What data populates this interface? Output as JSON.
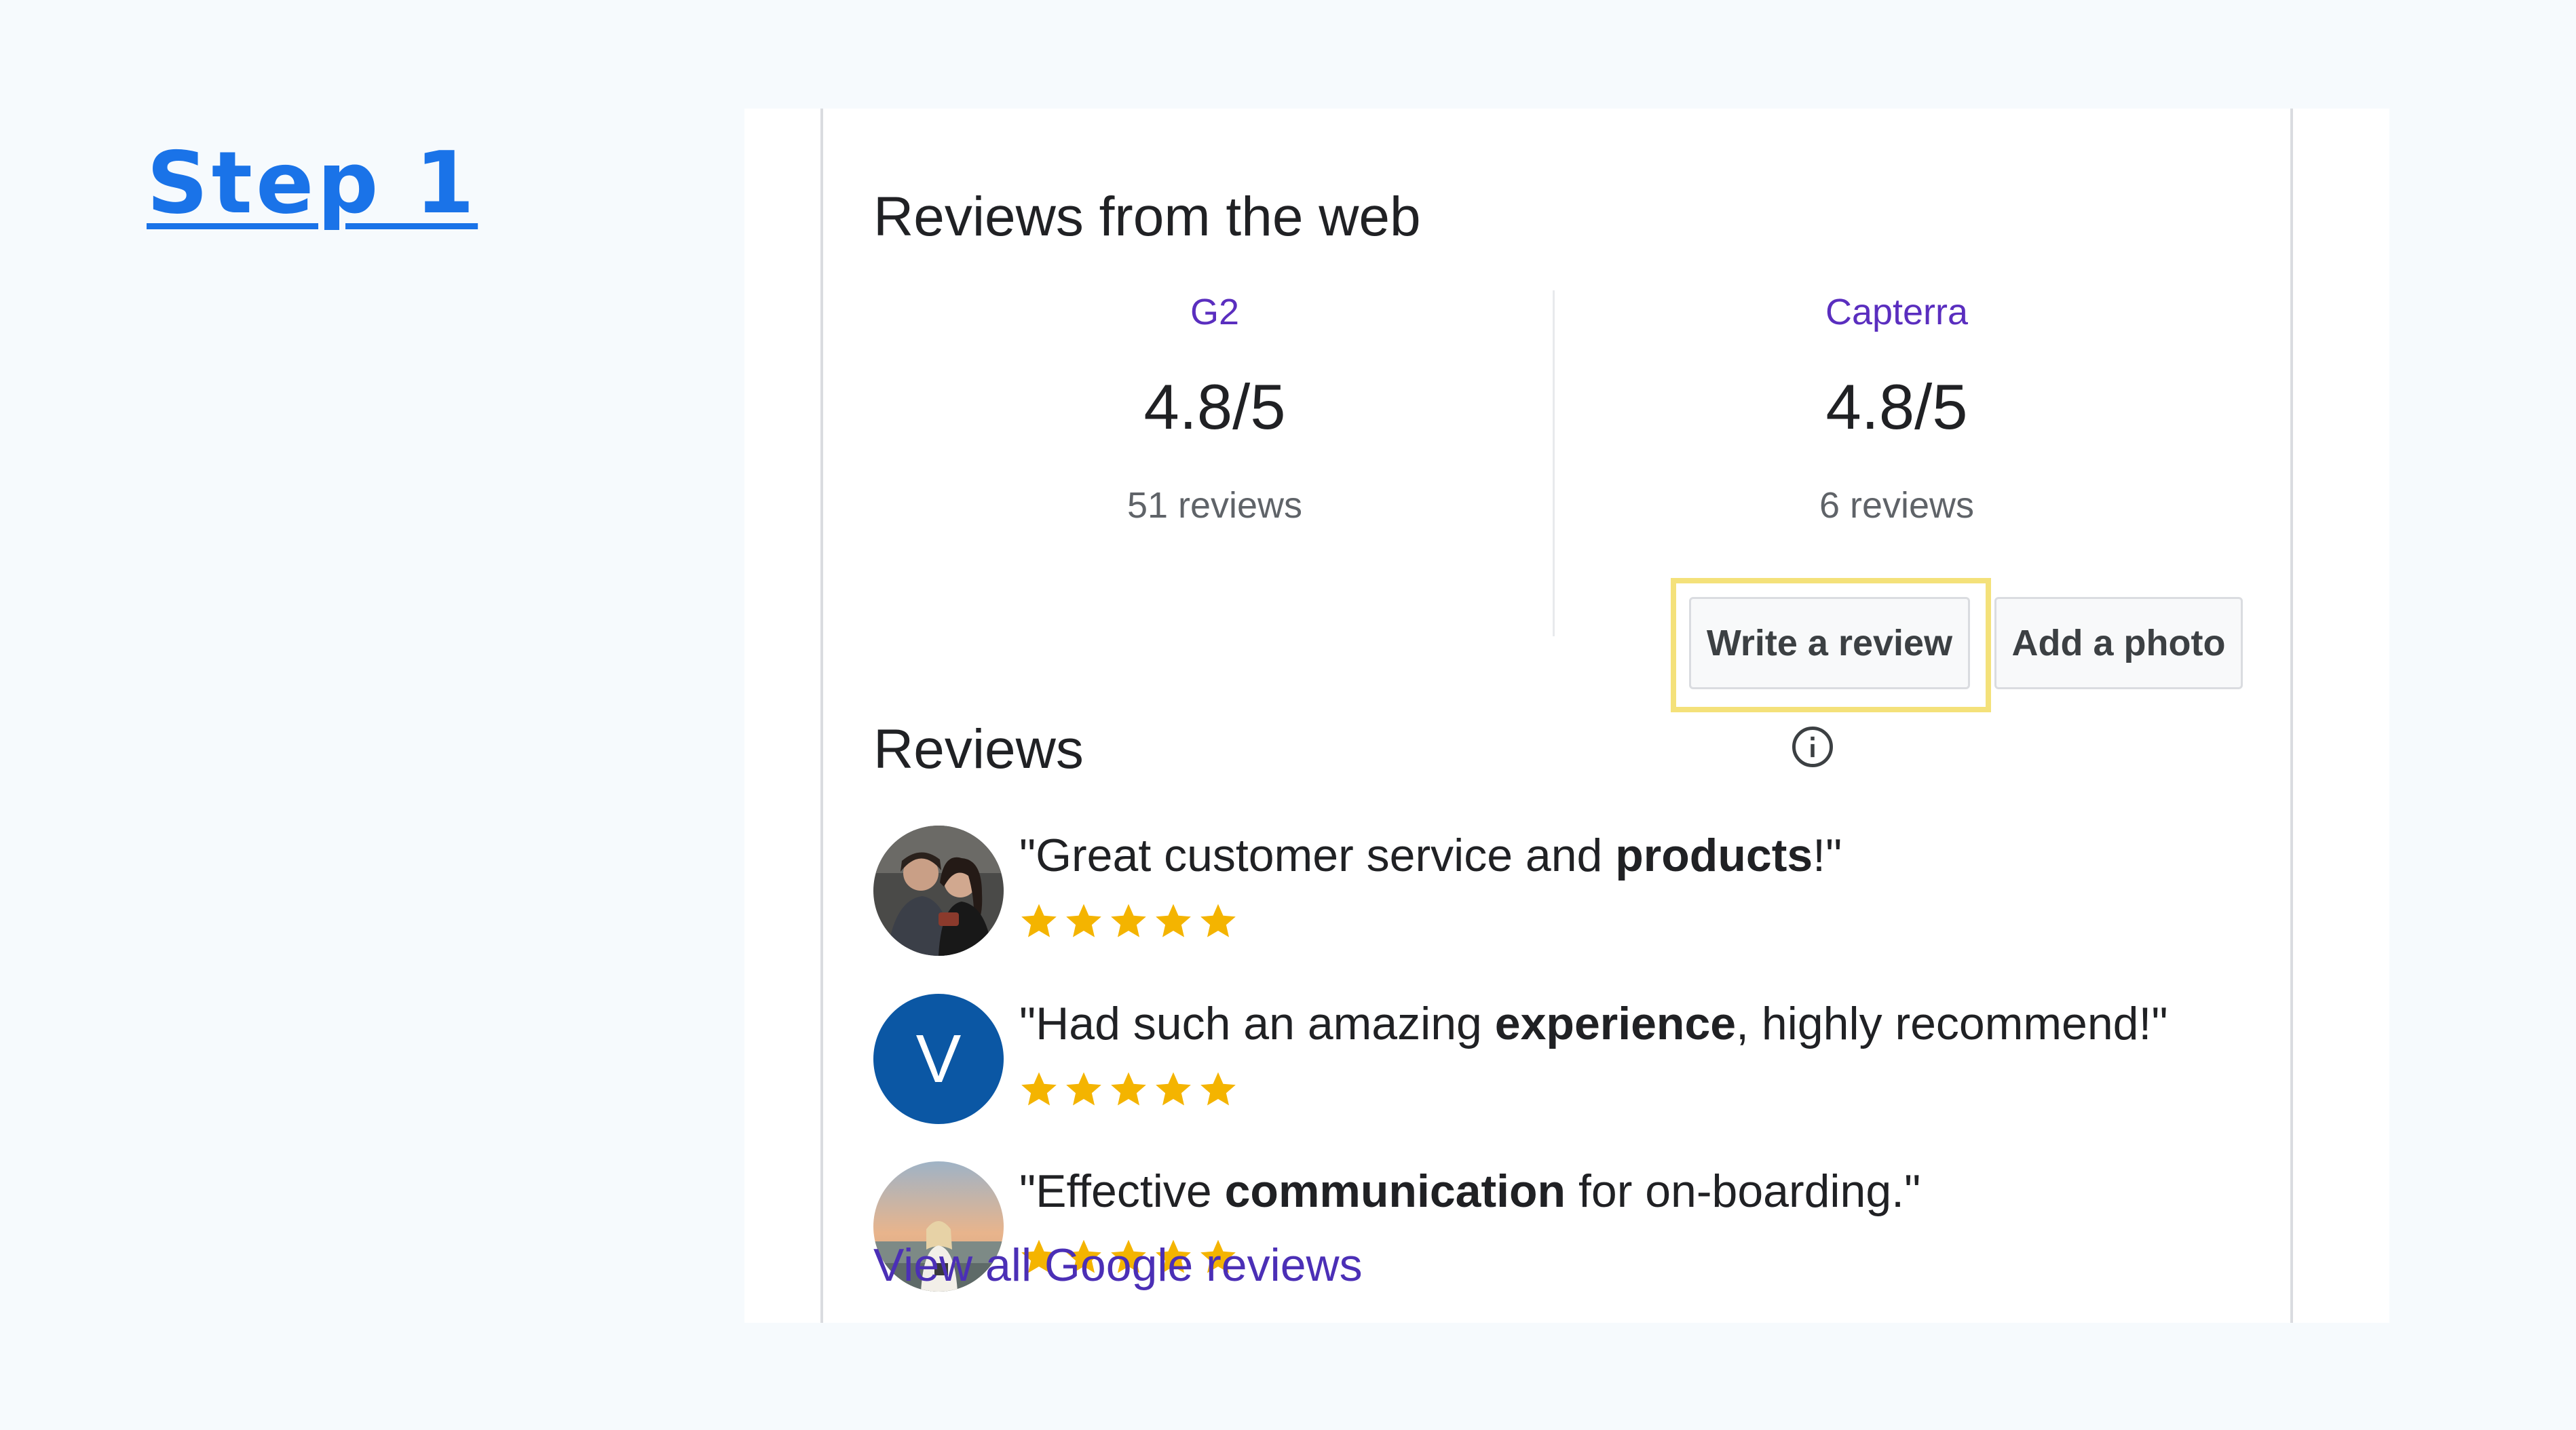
{
  "step": {
    "label": "Step 1"
  },
  "web_reviews": {
    "title": "Reviews from the web",
    "sources": [
      {
        "name": "G2",
        "rating": "4.8/5",
        "count": "51 reviews"
      },
      {
        "name": "Capterra",
        "rating": "4.8/5",
        "count": "6 reviews"
      }
    ]
  },
  "reviews": {
    "title": "Reviews",
    "write_label": "Write a review",
    "photo_label": "Add a photo",
    "items": [
      {
        "pre": "\"Great customer service and ",
        "bold": "products",
        "post": "!\"",
        "stars": 5,
        "avatar": "photo-couple"
      },
      {
        "pre": "\"Had such an amazing ",
        "bold": "experience",
        "post": ", highly recommend!\"",
        "stars": 5,
        "avatar_letter": "V"
      },
      {
        "pre": "\"Effective ",
        "bold": "communication",
        "post": " for on-boarding.\"",
        "stars": 5,
        "avatar": "photo-beach"
      }
    ],
    "view_all": "View all Google reviews"
  },
  "colors": {
    "accent": "#1a73e8",
    "link": "#4b2fb6",
    "star": "#f4b400",
    "highlight": "#f4e17a",
    "avatar_v": "#0b57a4"
  },
  "icons": [
    "info-icon",
    "star-icon"
  ]
}
